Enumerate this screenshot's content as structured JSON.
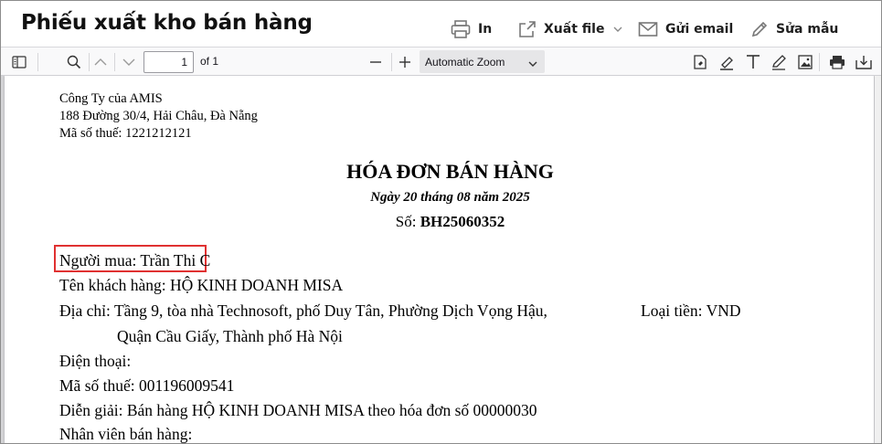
{
  "header": {
    "title": "Phiếu xuất kho bán hàng",
    "print_label": "In",
    "export_label": "Xuất file",
    "email_label": "Gửi email",
    "edit_template_label": "Sửa mẫu"
  },
  "toolbar": {
    "page_number": "1",
    "page_total": "of 1",
    "zoom": "Automatic Zoom"
  },
  "document": {
    "company_name": "Công Ty của AMIS",
    "company_address": "188 Đường 30/4, Hải Châu, Đà Nẵng",
    "company_tax": "Mã số thuế: 1221212121",
    "title": "HÓA ĐƠN BÁN HÀNG",
    "date": "Ngày 20 tháng 08 năm 2025",
    "number_label": "Số:",
    "number_value": "BH25060352",
    "buyer": "Người mua: Trần Thi C",
    "customer": "Tên khách hàng: HỘ KINH DOANH MISA",
    "address_line1": "Địa chỉ: Tầng 9, tòa nhà Technosoft, phố Duy Tân, Phường Dịch Vọng Hậu,",
    "address_line2": "Quận Cầu Giấy, Thành phố Hà Nội",
    "currency": "Loại tiền: VND",
    "phone": "Điện thoại:",
    "tax_code": "Mã số thuế: 001196009541",
    "description": "Diễn giải: Bán hàng HỘ KINH DOANH MISA theo hóa đơn số 00000030",
    "salesperson": "Nhân viên bán hàng:"
  }
}
